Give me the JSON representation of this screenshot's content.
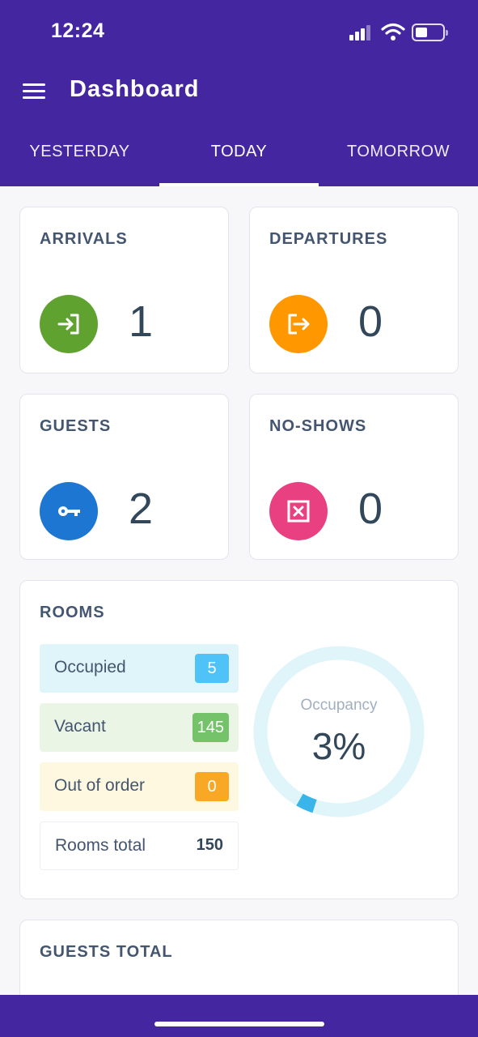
{
  "status_bar": {
    "time": "12:24"
  },
  "header": {
    "title": "Dashboard"
  },
  "tabs": [
    {
      "label": "YESTERDAY"
    },
    {
      "label": "TODAY",
      "active": true
    },
    {
      "label": "TOMORROW"
    }
  ],
  "stats": {
    "arrivals": {
      "title": "ARRIVALS",
      "value": "1",
      "icon": "login-arrow-icon",
      "color": "#5fa22f"
    },
    "departures": {
      "title": "DEPARTURES",
      "value": "0",
      "icon": "logout-arrow-icon",
      "color": "#ff9800"
    },
    "guests": {
      "title": "GUESTS",
      "value": "2",
      "icon": "key-icon",
      "color": "#1c76d2"
    },
    "no_shows": {
      "title": "NO-SHOWS",
      "value": "0",
      "icon": "close-box-icon",
      "color": "#e94082"
    }
  },
  "rooms": {
    "title": "ROOMS",
    "occupied": {
      "label": "Occupied",
      "value": "5",
      "bg": "#dff5f9",
      "badge": "#4fc3f7"
    },
    "vacant": {
      "label": "Vacant",
      "value": "145",
      "bg": "#eaf5e6",
      "badge": "#74c36b"
    },
    "out_of_order": {
      "label": "Out of order",
      "value": "0",
      "bg": "#fff8e1",
      "badge": "#f9a825"
    },
    "total": {
      "label": "Rooms total",
      "value": "150"
    },
    "occupancy": {
      "label": "Occupancy",
      "value": "3%",
      "fraction": 0.0333
    }
  },
  "guests_total": {
    "title": "GUESTS TOTAL"
  },
  "colors": {
    "brand": "#4427a0"
  }
}
